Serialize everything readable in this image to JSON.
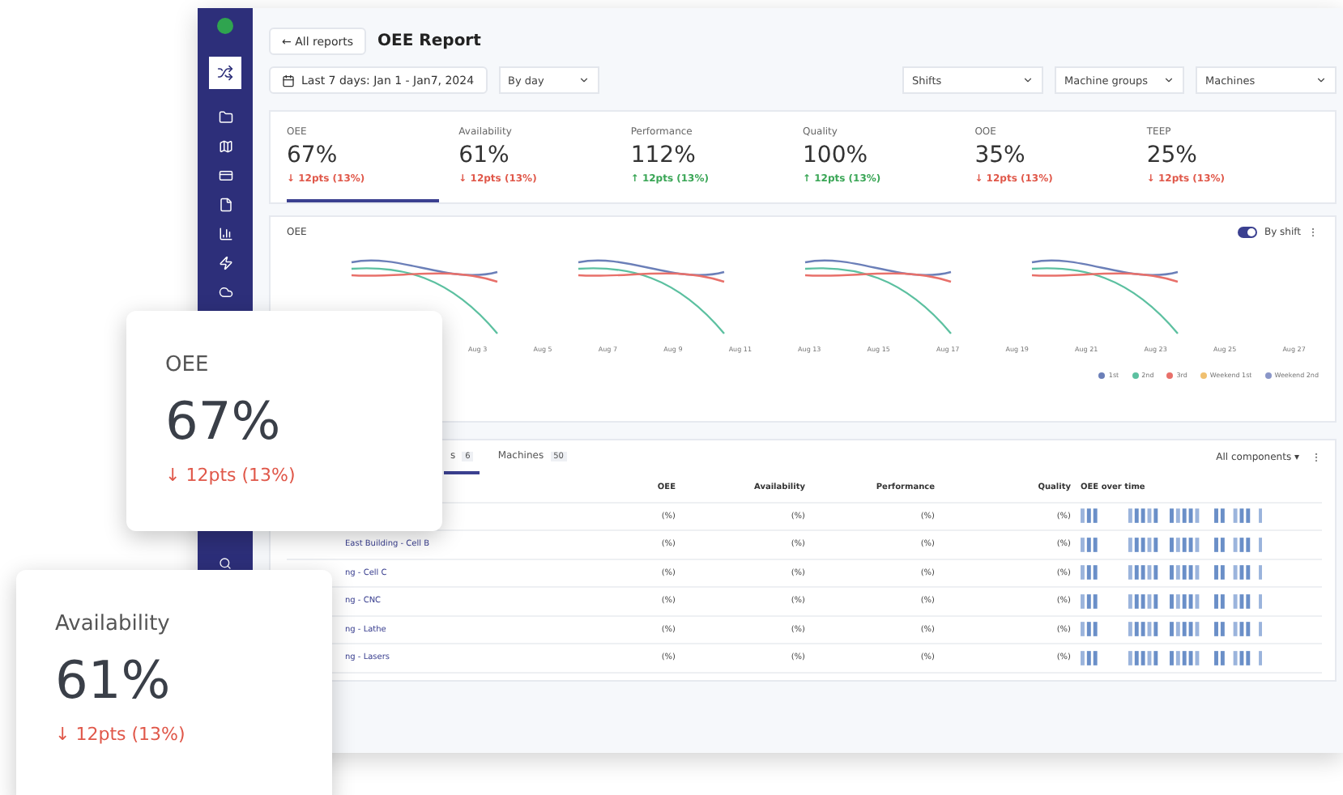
{
  "header": {
    "back_button": "← All reports",
    "title": "OEE Report"
  },
  "filters": {
    "date_range": "Last 7 days:  Jan 1  -  Jan7, 2024",
    "granularity": "By day",
    "selects": [
      "Shifts",
      "Machine groups",
      "Machines"
    ]
  },
  "kpis": [
    {
      "label": "OEE",
      "value": "67%",
      "delta": "↓ 12pts (13%)",
      "color": "#e0584a",
      "selected": true
    },
    {
      "label": "Availability",
      "value": "61%",
      "delta": "↓ 12pts (13%)",
      "color": "#e0584a",
      "selected": false
    },
    {
      "label": "Performance",
      "value": "112%",
      "delta": "↑ 12pts (13%)",
      "color": "#3aa656",
      "selected": false
    },
    {
      "label": "Quality",
      "value": "100%",
      "delta": "↑ 12pts (13%)",
      "color": "#3aa656",
      "selected": false
    },
    {
      "label": "OOE",
      "value": "35%",
      "delta": "↓ 12pts (13%)",
      "color": "#e0584a",
      "selected": false
    },
    {
      "label": "TEEP",
      "value": "25%",
      "delta": "↓ 12pts (13%)",
      "color": "#e0584a",
      "selected": false
    }
  ],
  "chart": {
    "title": "OEE",
    "toggle": {
      "label": "By shift",
      "on": true
    },
    "x_labels": [
      "Aug 3",
      "Aug 5",
      "Aug 7",
      "Aug 9",
      "Aug 11",
      "Aug 13",
      "Aug 15",
      "Aug 17",
      "Aug 19",
      "Aug 21",
      "Aug 23",
      "Aug 25",
      "Aug 27"
    ],
    "legend": [
      {
        "label": "1st",
        "color": "#6b7fb8"
      },
      {
        "label": "2nd",
        "color": "#5cc0a0"
      },
      {
        "label": "3rd",
        "color": "#e8706a"
      },
      {
        "label": "Weekend 1st",
        "color": "#f0c070"
      },
      {
        "label": "Weekend 2nd",
        "color": "#8a96c8"
      }
    ]
  },
  "table": {
    "tabs": [
      {
        "label": "s",
        "count": "6",
        "selected": true
      },
      {
        "label": "Machines",
        "count": "50",
        "selected": false
      }
    ],
    "filter": "All components ▾",
    "columns": [
      "OEE",
      "Availability",
      "Performance",
      "Quality",
      "OEE over time"
    ],
    "rows": [
      {
        "cells": [
          "(%)",
          "(%)",
          "(%)",
          "(%)"
        ]
      },
      {
        "name": "East Building - Cell B",
        "cells": [
          "(%)",
          "(%)",
          "(%)",
          "(%)"
        ]
      },
      {
        "name": "ng - Cell C",
        "cells": [
          "(%)",
          "(%)",
          "(%)",
          "(%)"
        ]
      },
      {
        "name": "ng - CNC",
        "cells": [
          "(%)",
          "(%)",
          "(%)",
          "(%)"
        ]
      },
      {
        "name": "ng - Lathe",
        "cells": [
          "(%)",
          "(%)",
          "(%)",
          "(%)"
        ]
      },
      {
        "name": "ng - Lasers",
        "cells": [
          "(%)",
          "(%)",
          "(%)",
          "(%)"
        ]
      }
    ]
  },
  "cards": [
    {
      "label": "OEE",
      "value": "67%",
      "delta": "↓ 12pts (13%)",
      "color": "#e0584a"
    },
    {
      "label": "Availability",
      "value": "61%",
      "delta": "↓ 12pts (13%)",
      "color": "#e0584a"
    }
  ]
}
